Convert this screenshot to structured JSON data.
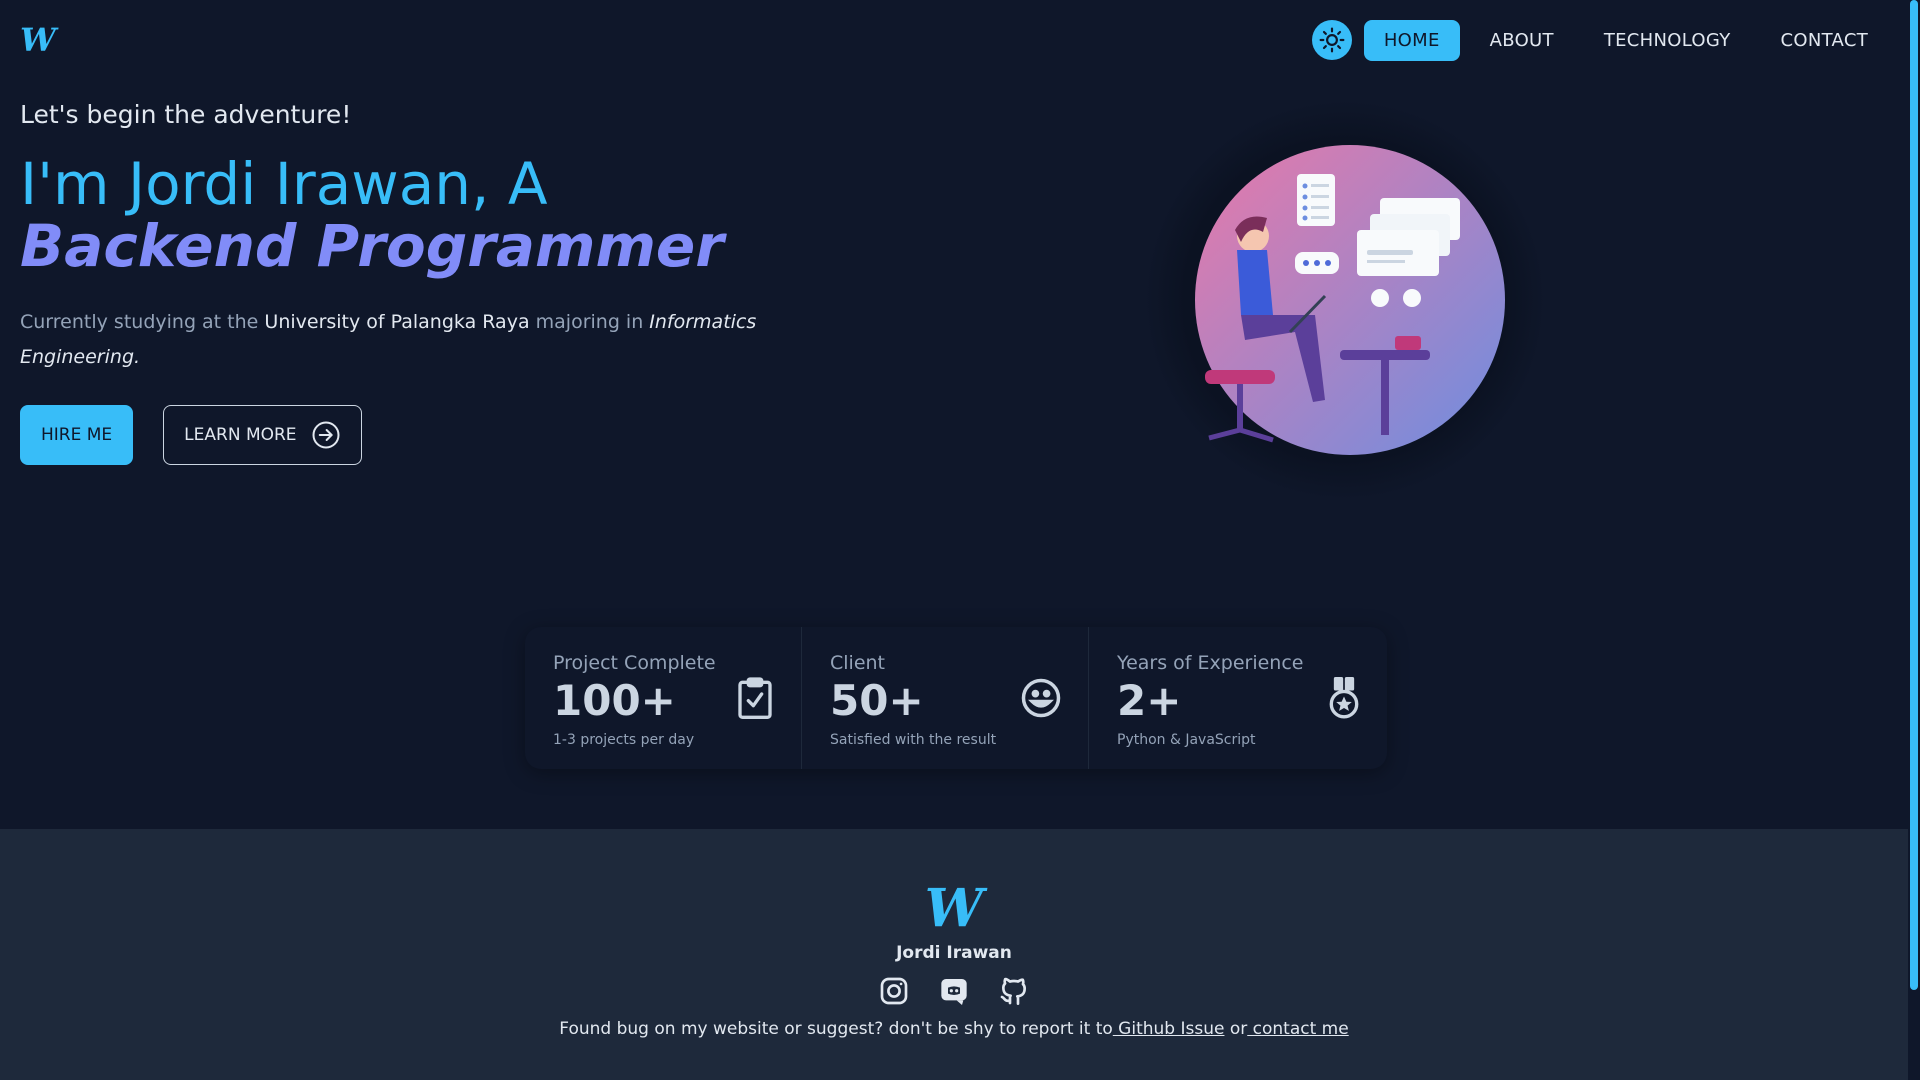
{
  "brand": {
    "logo_text": "W"
  },
  "nav": {
    "theme_toggle_icon": "sun-icon",
    "items": [
      {
        "label": "HOME",
        "active": true
      },
      {
        "label": "ABOUT",
        "active": false
      },
      {
        "label": "TECHNOLOGY",
        "active": false
      },
      {
        "label": "CONTACT",
        "active": false
      }
    ]
  },
  "hero": {
    "tagline": "Let's begin the adventure!",
    "headline": "I'm Jordi Irawan, A",
    "role": "Backend Programmer",
    "desc_pre": "Currently studying at the ",
    "desc_university": "University of Palangka Raya",
    "desc_mid": " majoring in ",
    "desc_major": "Informatics Engineering.",
    "hire_label": "HIRE ME",
    "learn_label": "LEARN MORE",
    "learn_icon": "arrow-right-circle-icon"
  },
  "stats": [
    {
      "title": "Project Complete",
      "value": "100+",
      "desc": "1-3 projects per day",
      "icon": "clipboard-check-icon"
    },
    {
      "title": "Client",
      "value": "50+",
      "desc": "Satisfied with the result",
      "icon": "smile-icon"
    },
    {
      "title": "Years of Experience",
      "value": "2+",
      "desc": "Python & JavaScript",
      "icon": "medal-icon"
    }
  ],
  "footer": {
    "logo_text": "W",
    "name": "Jordi Irawan",
    "socials": [
      "instagram-icon",
      "discord-icon",
      "github-icon"
    ],
    "note_pre": "Found bug on my website or suggest? don't be shy to report it to",
    "link_github": " Github Issue",
    "note_mid": " or",
    "link_contact": " contact me"
  },
  "colors": {
    "background": "#0f172a",
    "accent": "#38bdf8",
    "accent_alt": "#818cf8",
    "footer_bg": "#1e293b"
  }
}
